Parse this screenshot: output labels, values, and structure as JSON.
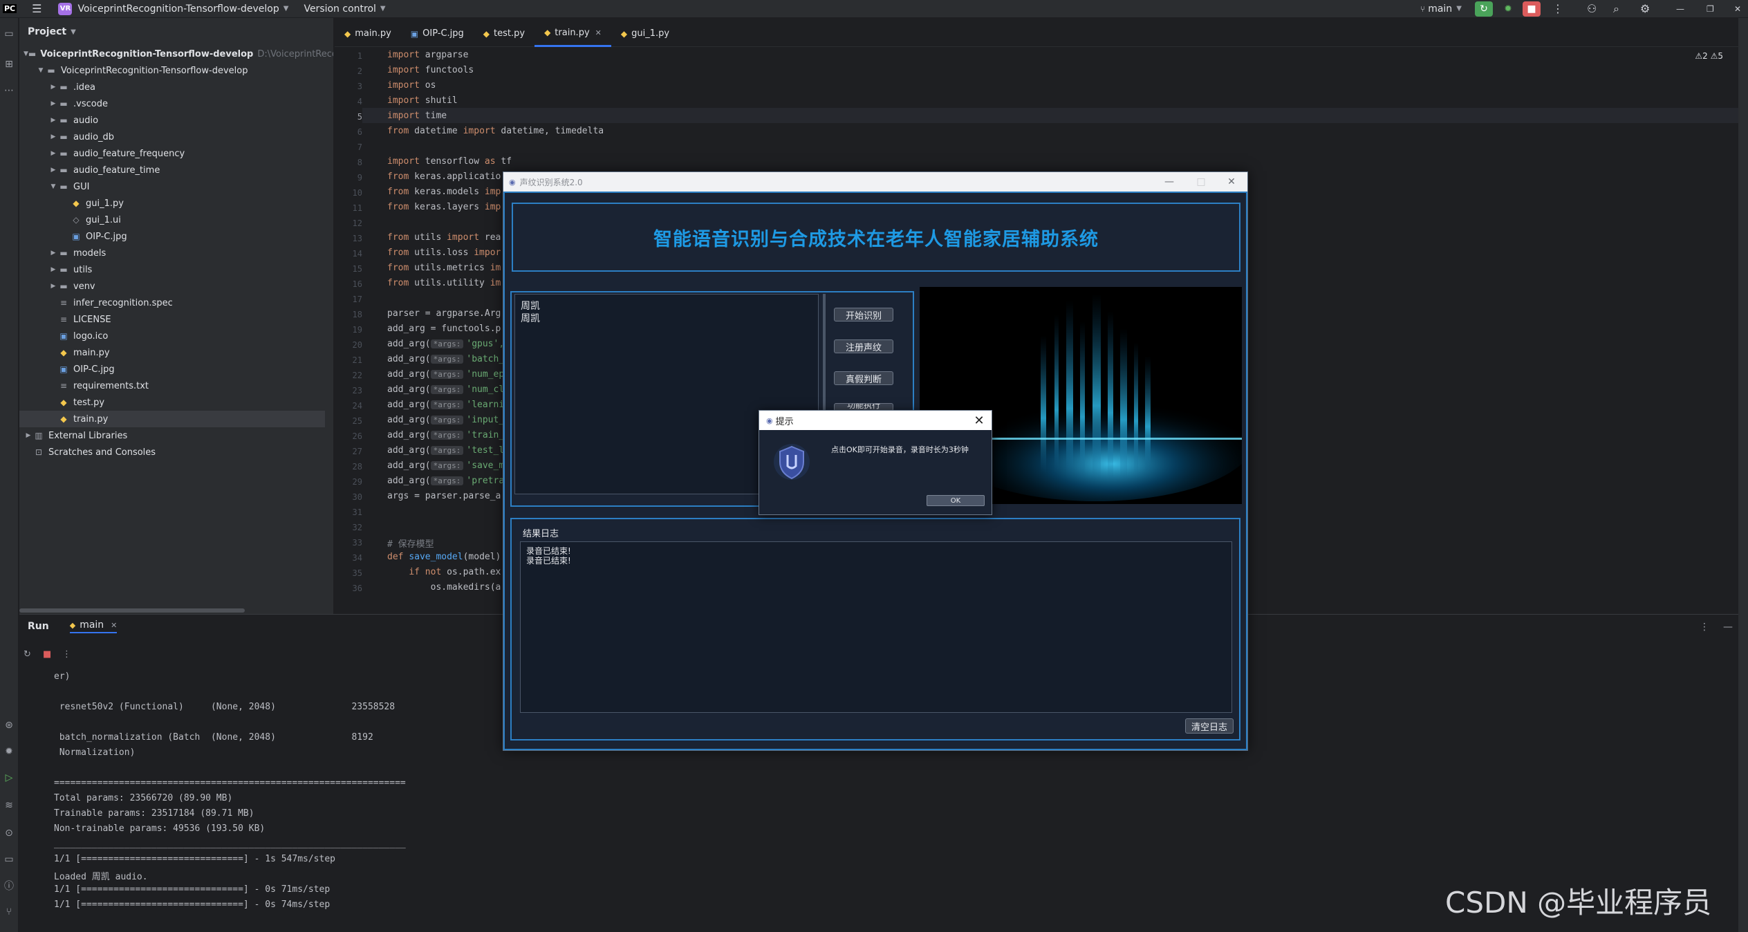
{
  "topbar": {
    "project_badge": "VR",
    "project_name": "VoiceprintRecognition-Tensorflow-develop",
    "version_control": "Version control",
    "branch": "main"
  },
  "project_panel": {
    "title": "Project",
    "tree": [
      {
        "label": "VoiceprintRecognition-Tensorflow-develop",
        "extra": "D:\\VoiceprintRecogn",
        "type": "folder",
        "depth": 0,
        "open": true
      },
      {
        "label": "VoiceprintRecognition-Tensorflow-develop",
        "type": "folder",
        "depth": 1,
        "open": true
      },
      {
        "label": ".idea",
        "type": "folder",
        "depth": 2
      },
      {
        "label": ".vscode",
        "type": "folder",
        "depth": 2
      },
      {
        "label": "audio",
        "type": "folder",
        "depth": 2
      },
      {
        "label": "audio_db",
        "type": "folder",
        "depth": 2
      },
      {
        "label": "audio_feature_frequency",
        "type": "folder",
        "depth": 2
      },
      {
        "label": "audio_feature_time",
        "type": "folder",
        "depth": 2
      },
      {
        "label": "GUI",
        "type": "folder",
        "depth": 2,
        "open": true
      },
      {
        "label": "gui_1.py",
        "type": "py",
        "depth": 3
      },
      {
        "label": "gui_1.ui",
        "type": "ui",
        "depth": 3
      },
      {
        "label": "OIP-C.jpg",
        "type": "img",
        "depth": 3
      },
      {
        "label": "models",
        "type": "folder",
        "depth": 2
      },
      {
        "label": "utils",
        "type": "folder",
        "depth": 2
      },
      {
        "label": "venv",
        "type": "folder",
        "depth": 2
      },
      {
        "label": "infer_recognition.spec",
        "type": "txt",
        "depth": 2
      },
      {
        "label": "LICENSE",
        "type": "txt",
        "depth": 2
      },
      {
        "label": "logo.ico",
        "type": "img",
        "depth": 2
      },
      {
        "label": "main.py",
        "type": "py",
        "depth": 2
      },
      {
        "label": "OIP-C.jpg",
        "type": "img",
        "depth": 2
      },
      {
        "label": "requirements.txt",
        "type": "txt",
        "depth": 2
      },
      {
        "label": "test.py",
        "type": "py",
        "depth": 2
      },
      {
        "label": "train.py",
        "type": "py",
        "depth": 2,
        "selected": true
      },
      {
        "label": "External Libraries",
        "type": "lib",
        "depth": 0
      },
      {
        "label": "Scratches and Consoles",
        "type": "scratch",
        "depth": 0
      }
    ]
  },
  "tabs": [
    {
      "label": "main.py",
      "type": "py"
    },
    {
      "label": "OIP-C.jpg",
      "type": "img"
    },
    {
      "label": "test.py",
      "type": "py"
    },
    {
      "label": "train.py",
      "type": "py",
      "active": true
    },
    {
      "label": "gui_1.py",
      "type": "py"
    }
  ],
  "editor": {
    "warnings": "⚠2 ⚠5",
    "lines": [
      "<span class='kw'>import</span> argparse",
      "<span class='kw'>import</span> functools",
      "<span class='kw'>import</span> os",
      "<span class='kw'>import</span> shutil",
      "<span class='kw'>import</span> time",
      "<span class='kw'>from</span> datetime <span class='kw'>import</span> datetime, timedelta",
      "",
      "<span class='kw'>import</span> tensorflow <span class='kw'>as</span> tf",
      "<span class='kw'>from</span> keras.applicatio",
      "<span class='kw'>from</span> keras.models <span class='kw'>imp</span>",
      "<span class='kw'>from</span> keras.layers <span class='kw'>imp</span>",
      "",
      "<span class='kw'>from</span> utils <span class='kw'>import</span> rea",
      "<span class='kw'>from</span> utils.loss <span class='kw'>impor</span>",
      "<span class='kw'>from</span> utils.metrics <span class='kw'>im</span>",
      "<span class='kw'>from</span> utils.utility <span class='kw'>im</span>",
      "",
      "parser = argparse.Arg",
      "add_arg = functools.p",
      "add_arg(<span class='hint'>*args:</span><span class='str'>'gpus',</span>",
      "add_arg(<span class='hint'>*args:</span><span class='str'>'batch_</span>",
      "add_arg(<span class='hint'>*args:</span><span class='str'>'num_ep</span>",
      "add_arg(<span class='hint'>*args:</span><span class='str'>'num_cl</span>",
      "add_arg(<span class='hint'>*args:</span><span class='str'>'learni</span>",
      "add_arg(<span class='hint'>*args:</span><span class='str'>'input_</span>",
      "add_arg(<span class='hint'>*args:</span><span class='str'>'train_</span>",
      "add_arg(<span class='hint'>*args:</span><span class='str'>'test_l</span>",
      "add_arg(<span class='hint'>*args:</span><span class='str'>'save_m</span>",
      "add_arg(<span class='hint'>*args:</span><span class='str'>'pretra</span>",
      "args = parser.parse_a",
      "",
      "",
      "<span class='cmt'># 保存模型</span>",
      "<span class='kw'>def</span> <span class='fn'>save_model</span>(model)",
      "    <span class='kw'>if not</span> os.path.ex",
      "        os.makedirs(a"
    ]
  },
  "run_panel": {
    "title": "Run",
    "config": "main",
    "lines": [
      "er)",
      "",
      " resnet50v2 (Functional)     (None, 2048)              23558528",
      "",
      " batch_normalization (Batch  (None, 2048)              8192",
      " Normalization)",
      "",
      "=================================================================",
      "Total params: 23566720 (89.90 MB)",
      "Trainable params: 23517184 (89.71 MB)",
      "Non-trainable params: 49536 (193.50 KB)",
      "_________________________________________________________________",
      "1/1 [==============================] - 1s 547ms/step",
      "Loaded 周凯 audio.",
      "1/1 [==============================] - 0s 71ms/step",
      "1/1 [==============================] - 0s 74ms/step"
    ]
  },
  "app_window": {
    "window_title": "声纹识别系统2.0",
    "title": "智能语音识别与合成技术在老年人智能家居辅助系统",
    "input_lines": [
      "周凯",
      "周凯"
    ],
    "buttons": [
      "开始识别",
      "注册声纹",
      "真假判断",
      "功能执行"
    ],
    "log_title": "结果日志",
    "log_lines": [
      "录音已结束!",
      "录音已结束!"
    ],
    "clear_button": "清空日志"
  },
  "message_box": {
    "title": "提示",
    "text": "点击OK即可开始录音，录音时长为3秒钟",
    "ok": "OK"
  },
  "watermark": "CSDN @毕业程序员",
  "colors": {
    "accent_blue": "#2c7fc4",
    "title_blue": "#1e9ae4"
  }
}
